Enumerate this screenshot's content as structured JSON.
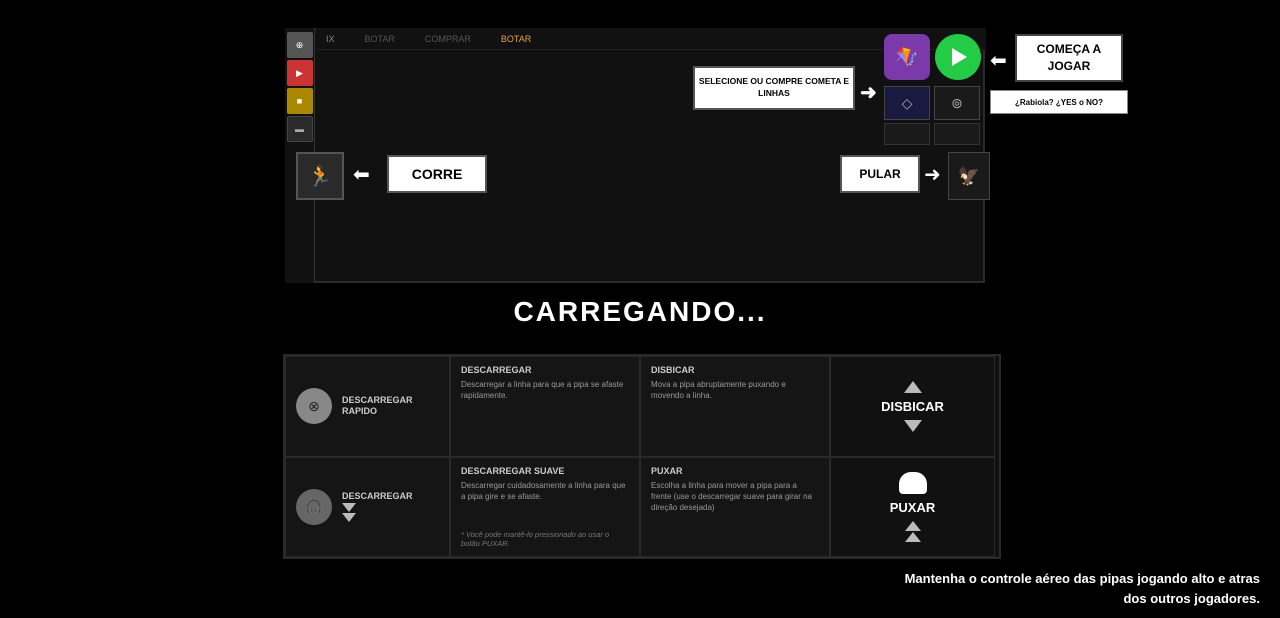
{
  "topbar": {
    "items": [
      "IX",
      "BOTAR",
      "COMPRAR",
      "BOTAR"
    ]
  },
  "game": {
    "select_label": "SELECIONE OU COMPRE\nCOMETA E LINHAS",
    "start_label": "COMEÇA\nA JOGAR",
    "rabiola_label": "¿Rabiola? ¿YES o NO?",
    "corre_label": "CORRE",
    "pular_label": "PULAR"
  },
  "loading": {
    "text": "CARREGANDO..."
  },
  "controls": {
    "fast_unload": {
      "title": "DESCARREGAR\nRAPIDO",
      "tooltip_title": "DESCARREGAR",
      "tooltip_desc": "Descarregar a linha para que a pipa se afaste rapidamente."
    },
    "disbicar_top": {
      "tooltip_title": "DISBICAR",
      "tooltip_desc": "Mova a pipa abruptamente puxando e movendo a linha.",
      "label": "DISBICAR"
    },
    "slow_unload": {
      "title": "DESCARREGAR",
      "tooltip_title": "DESCARREGAR SUAVE",
      "tooltip_desc": "Descarregar cuidadosamente a linha para que a pipa gire e se afaste."
    },
    "puxar": {
      "tooltip_title": "PUXAR",
      "tooltip_desc": "Escolha a linha para mover a pipa para a frente (use o descarregar suave para girar na direção desejada)",
      "label": "PUXAR"
    },
    "note": "* Você pode mantê-lo pressionado ao usar o botão PUXAR."
  },
  "footer": {
    "line1": "Mantenha o controle aéreo das pipas jogando alto e atras",
    "line2": "dos outros jogadores."
  }
}
